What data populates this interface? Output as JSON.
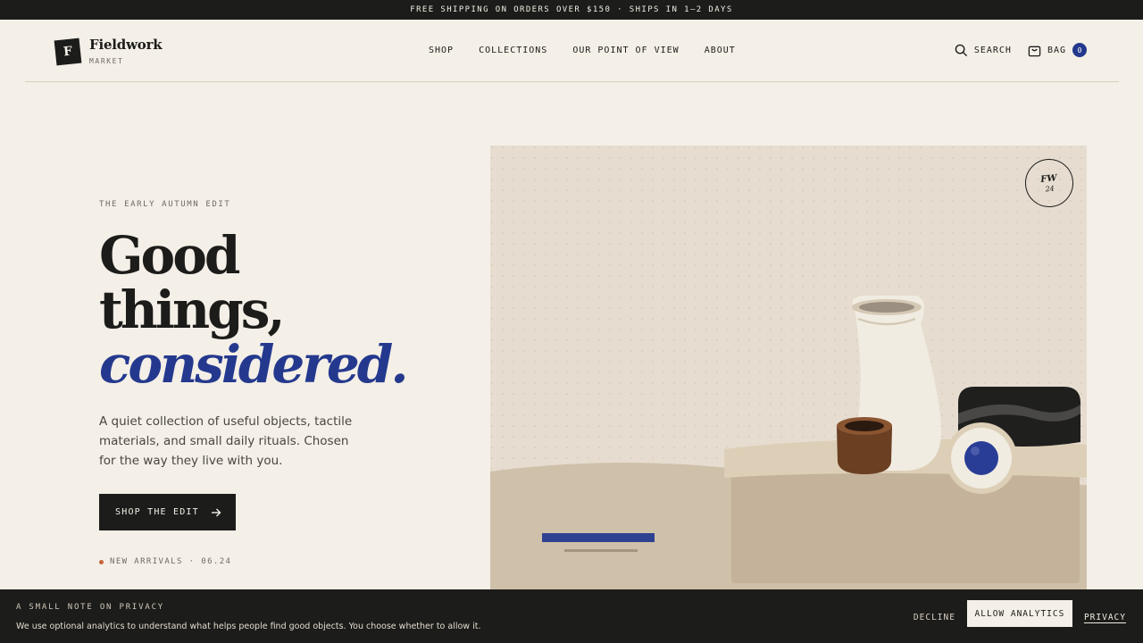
{
  "announcement": "FREE SHIPPING ON ORDERS OVER $150 · SHIPS IN 1–2 DAYS",
  "brand": {
    "mark": "F",
    "name": "Fieldwork",
    "sub": "MARKET"
  },
  "nav": {
    "items": [
      "SHOP",
      "COLLECTIONS",
      "OUR POINT OF VIEW",
      "ABOUT"
    ]
  },
  "header": {
    "search_label": "SEARCH",
    "bag_label": "BAG",
    "bag_count": "0"
  },
  "hero": {
    "kicker": "THE EARLY AUTUMN EDIT",
    "headline_1": "Good",
    "headline_2": "things,",
    "headline_3": "considered.",
    "lede": "A quiet collection of useful objects, tactile materials, and small daily rituals. Chosen for the way they live with you.",
    "cta_label": "SHOP THE EDIT",
    "arrivals": "NEW ARRIVALS · 06.24",
    "badge_line_1": "FW",
    "badge_line_2": "24"
  },
  "cookie": {
    "title": "A SMALL NOTE ON PRIVACY",
    "text": "We use optional analytics to understand what helps people find good objects. You choose whether to allow it.",
    "decline_label": "DECLINE",
    "allow_label": "ALLOW ANALYTICS",
    "privacy_label": "PRIVACY"
  },
  "colors": {
    "accent": "#24398e",
    "ink": "#1c1c1a",
    "paper": "#f4efe7",
    "dot": "#c4643a"
  },
  "icons": {
    "search": "search-icon",
    "bag": "bag-icon",
    "arrow": "arrow-right-icon"
  }
}
